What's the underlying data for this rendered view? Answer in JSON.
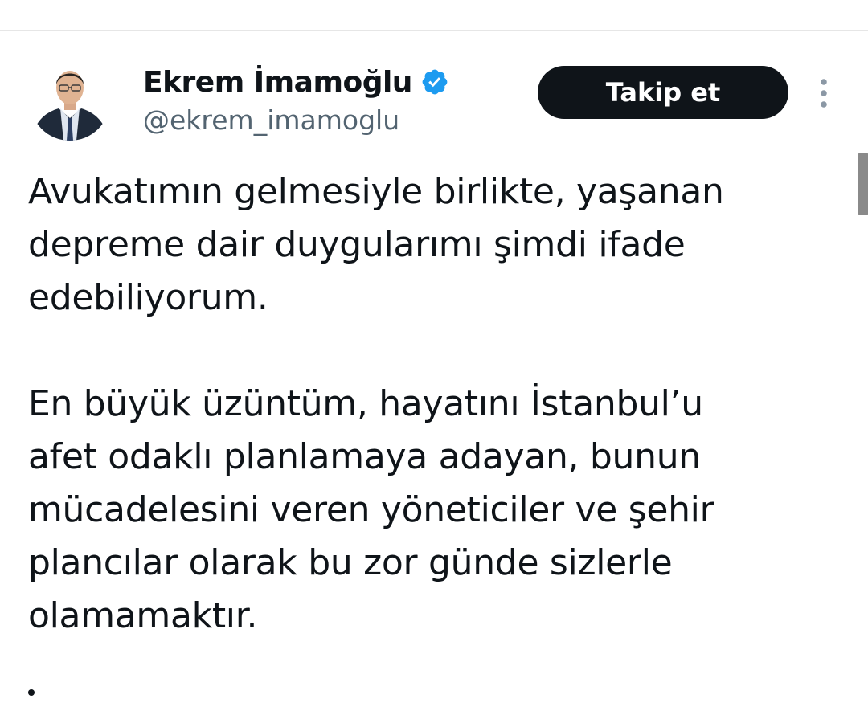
{
  "profile": {
    "display_name": "Ekrem İmamoğlu",
    "handle": "@ekrem_imamoglu",
    "verified_icon": "verified-badge-icon",
    "avatar_icon": "profile-avatar"
  },
  "actions": {
    "follow_label": "Takip et",
    "more_icon": "more-options-icon"
  },
  "tweet": {
    "paragraph_1": [
      "Avukatımın gelmesiyle birlikte, yaşanan",
      "depreme dair duygularımı şimdi ifade",
      "edebiliyorum."
    ],
    "paragraph_2": [
      "En büyük üzüntüm, hayatını İstanbul’u",
      "afet odaklı planlamaya adayan, bunun",
      "mücadelesini veren yöneticiler ve şehir",
      "plancılar olarak bu zor günde sizlerle",
      "olamamaktır."
    ]
  },
  "colors": {
    "text_primary": "#0f1419",
    "text_secondary": "#536471",
    "verified_blue": "#1d9bf0",
    "button_bg": "#0f1419",
    "button_text": "#ffffff"
  }
}
